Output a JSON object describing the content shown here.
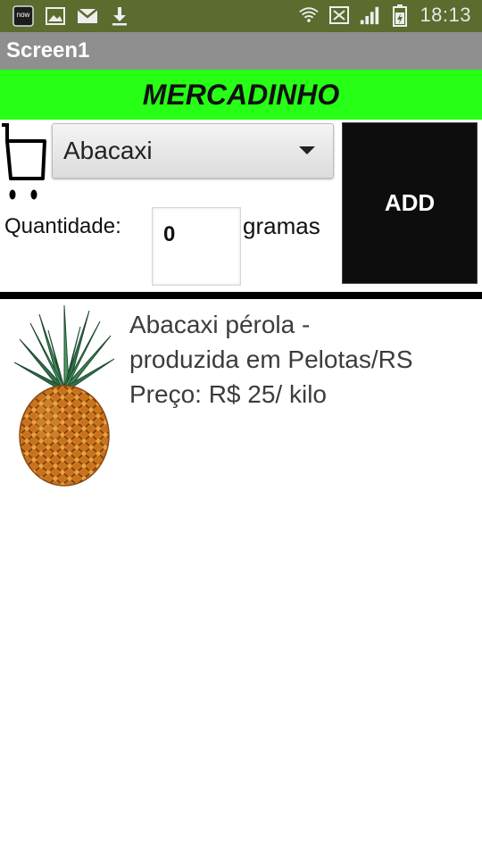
{
  "status_bar": {
    "time": "18:13",
    "left_icons": [
      "now-app-icon",
      "image-icon",
      "gmail-icon",
      "download-icon"
    ],
    "right_icons": [
      "wifi-icon",
      "sms-icon",
      "signal-icon",
      "battery-icon"
    ],
    "now_icon_text": "now"
  },
  "app_bar": {
    "title": "Screen1"
  },
  "banner": {
    "title": "MERCADINHO"
  },
  "product_picker": {
    "selected": "Abacaxi"
  },
  "quantity": {
    "label": "Quantidade:",
    "value": "0",
    "unit": "gramas"
  },
  "add_button": {
    "label": "ADD"
  },
  "product": {
    "description_lines": [
      "Abacaxi pérola -",
      "produzida em Pelotas/RS",
      "Preço: R$ 25/ kilo"
    ]
  },
  "colors": {
    "status_bar": "#5c6b2e",
    "title_bar": "#8f8f8f",
    "banner": "#27ff17",
    "add_button": "#0d0d0d"
  }
}
